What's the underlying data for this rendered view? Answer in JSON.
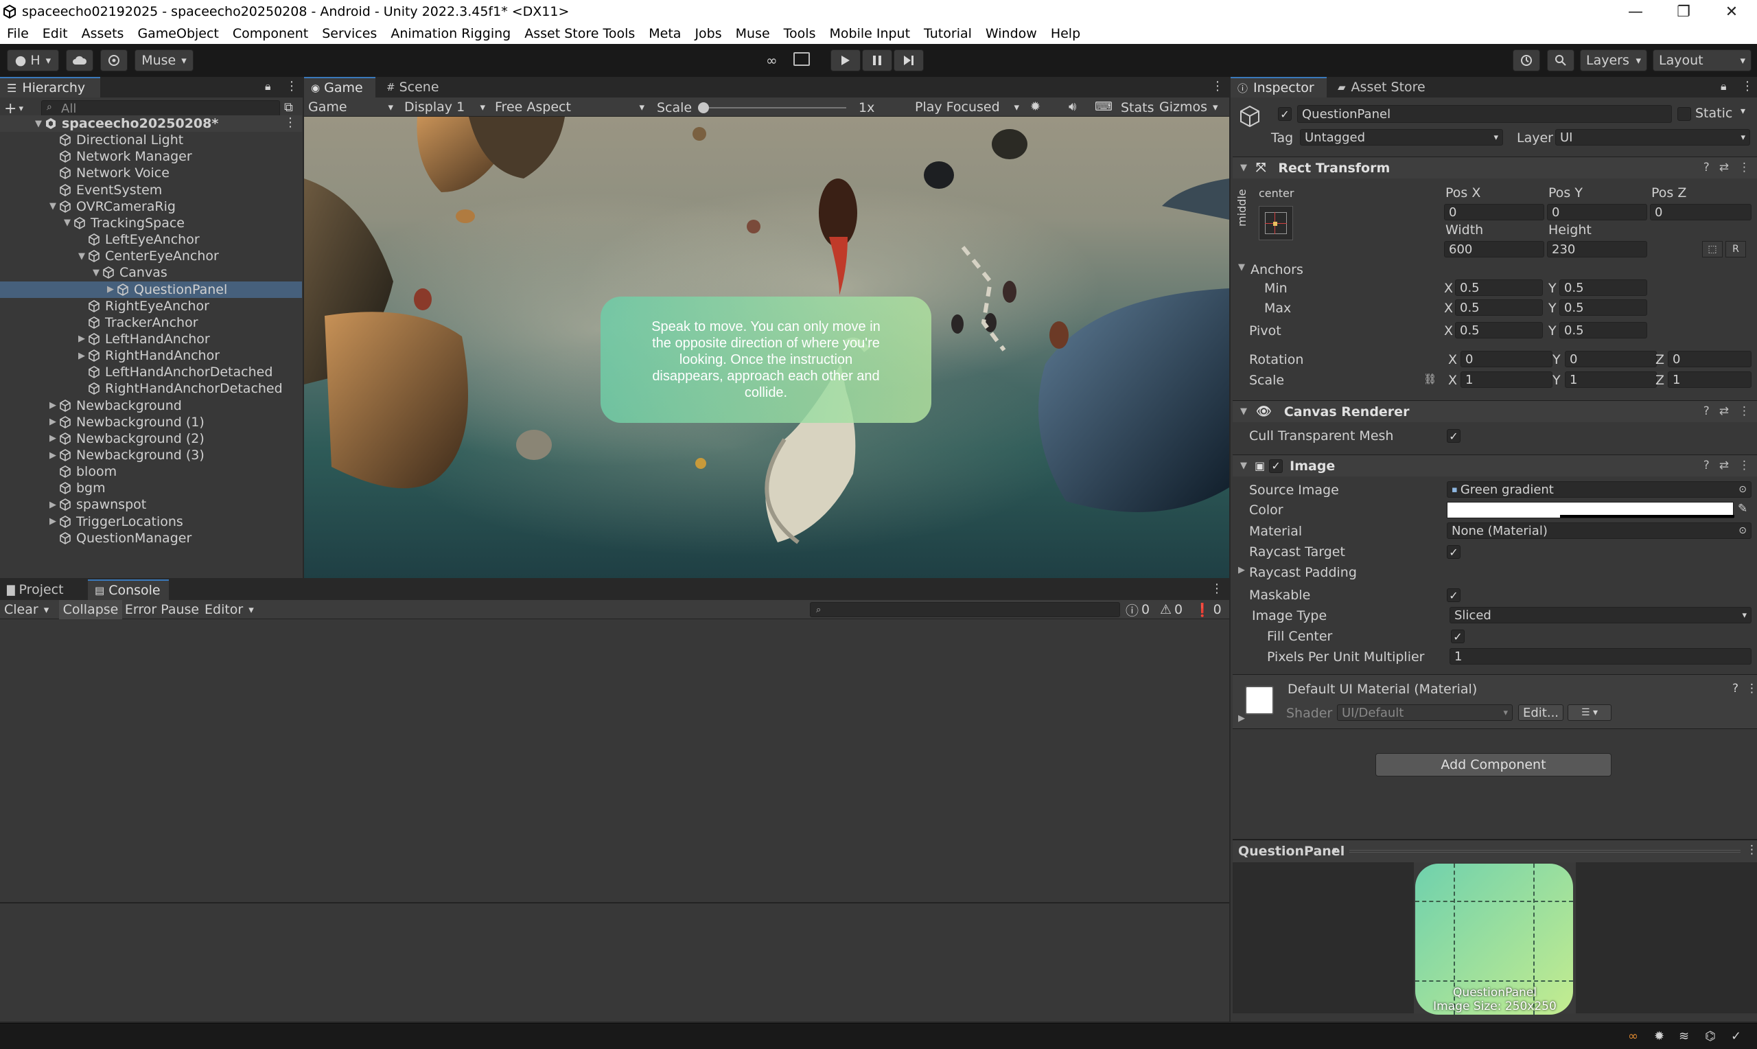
{
  "window": {
    "title": "spaceecho02192025 - spaceecho20250208 - Android - Unity 2022.3.45f1* <DX11>",
    "minimize": "—",
    "maximize": "❐",
    "close": "✕"
  },
  "menu": [
    "File",
    "Edit",
    "Assets",
    "GameObject",
    "Component",
    "Services",
    "Animation Rigging",
    "Asset Store Tools",
    "Meta",
    "Jobs",
    "Muse",
    "Tools",
    "Mobile Input",
    "Tutorial",
    "Window",
    "Help"
  ],
  "toolbar": {
    "account_label": "H",
    "muse_label": "Muse",
    "layers_label": "Layers",
    "layout_label": "Layout"
  },
  "hierarchy": {
    "tab": "Hierarchy",
    "search_placeholder": "All",
    "scene": "spaceecho20250208*",
    "items": [
      {
        "label": "Directional Light",
        "depth": 1,
        "arrow": ""
      },
      {
        "label": "Network Manager",
        "depth": 1,
        "arrow": ""
      },
      {
        "label": "Network Voice",
        "depth": 1,
        "arrow": ""
      },
      {
        "label": "EventSystem",
        "depth": 1,
        "arrow": ""
      },
      {
        "label": "OVRCameraRig",
        "depth": 1,
        "arrow": "▼"
      },
      {
        "label": "TrackingSpace",
        "depth": 2,
        "arrow": "▼"
      },
      {
        "label": "LeftEyeAnchor",
        "depth": 3,
        "arrow": ""
      },
      {
        "label": "CenterEyeAnchor",
        "depth": 3,
        "arrow": "▼"
      },
      {
        "label": "Canvas",
        "depth": 4,
        "arrow": "▼"
      },
      {
        "label": "QuestionPanel",
        "depth": 5,
        "arrow": "▶",
        "selected": true
      },
      {
        "label": "RightEyeAnchor",
        "depth": 3,
        "arrow": ""
      },
      {
        "label": "TrackerAnchor",
        "depth": 3,
        "arrow": ""
      },
      {
        "label": "LeftHandAnchor",
        "depth": 3,
        "arrow": "▶"
      },
      {
        "label": "RightHandAnchor",
        "depth": 3,
        "arrow": "▶"
      },
      {
        "label": "LeftHandAnchorDetached",
        "depth": 3,
        "arrow": ""
      },
      {
        "label": "RightHandAnchorDetached",
        "depth": 3,
        "arrow": ""
      },
      {
        "label": "Newbackground",
        "depth": 1,
        "arrow": "▶"
      },
      {
        "label": "Newbackground (1)",
        "depth": 1,
        "arrow": "▶"
      },
      {
        "label": "Newbackground (2)",
        "depth": 1,
        "arrow": "▶"
      },
      {
        "label": "Newbackground (3)",
        "depth": 1,
        "arrow": "▶"
      },
      {
        "label": "bloom",
        "depth": 1,
        "arrow": ""
      },
      {
        "label": "bgm",
        "depth": 1,
        "arrow": ""
      },
      {
        "label": "spawnspot",
        "depth": 1,
        "arrow": "▶"
      },
      {
        "label": "TriggerLocations",
        "depth": 1,
        "arrow": "▶"
      },
      {
        "label": "QuestionManager",
        "depth": 1,
        "arrow": ""
      }
    ]
  },
  "game": {
    "tab_game": "Game",
    "tab_scene": "Scene",
    "view_select": "Game",
    "display": "Display 1",
    "aspect": "Free Aspect",
    "scale_label": "Scale",
    "scale_value": "1x",
    "play_mode": "Play Focused",
    "stats": "Stats",
    "gizmos": "Gizmos",
    "instruction": "Speak to move. You can only move in the opposite direction of where you're looking. Once the instruction disappears, approach each other and collide."
  },
  "console": {
    "tab_project": "Project",
    "tab_console": "Console",
    "clear": "Clear",
    "collapse": "Collapse",
    "error_pause": "Error Pause",
    "editor": "Editor",
    "count_log": "0",
    "count_warn": "0",
    "count_error": "0"
  },
  "inspector": {
    "tab_inspector": "Inspector",
    "tab_asset_store": "Asset Store",
    "object_name": "QuestionPanel",
    "static_label": "Static",
    "tag_label": "Tag",
    "tag_value": "Untagged",
    "layer_label": "Layer",
    "layer_value": "UI",
    "rect": {
      "title": "Rect Transform",
      "anchor_h": "center",
      "anchor_v": "middle",
      "posx_label": "Pos X",
      "posy_label": "Pos Y",
      "posz_label": "Pos Z",
      "posx": "0",
      "posy": "0",
      "posz": "0",
      "width_label": "Width",
      "height_label": "Height",
      "width": "600",
      "height": "230",
      "anchors_label": "Anchors",
      "min_label": "Min",
      "max_label": "Max",
      "min_x": "0.5",
      "min_y": "0.5",
      "max_x": "0.5",
      "max_y": "0.5",
      "pivot_label": "Pivot",
      "pivot_x": "0.5",
      "pivot_y": "0.5",
      "rotation_label": "Rotation",
      "rot_x": "0",
      "rot_y": "0",
      "rot_z": "0",
      "scale_label": "Scale",
      "scale_x": "1",
      "scale_y": "1",
      "scale_z": "1",
      "x": "X",
      "y": "Y",
      "z": "Z"
    },
    "canvas_renderer": {
      "title": "Canvas Renderer",
      "cull_label": "Cull Transparent Mesh"
    },
    "image": {
      "title": "Image",
      "source_label": "Source Image",
      "source_value": "Green gradient",
      "color_label": "Color",
      "material_label": "Material",
      "material_value": "None (Material)",
      "raycast_label": "Raycast Target",
      "raycast_padding_label": "Raycast Padding",
      "maskable_label": "Maskable",
      "image_type_label": "Image Type",
      "image_type_value": "Sliced",
      "fill_center_label": "Fill Center",
      "ppu_label": "Pixels Per Unit Multiplier",
      "ppu_value": "1"
    },
    "material": {
      "title": "Default UI Material (Material)",
      "shader_label": "Shader",
      "shader_value": "UI/Default",
      "edit_label": "Edit..."
    },
    "add_component": "Add Component",
    "preview": {
      "title": "QuestionPanel",
      "caption_line1": "QuestionPanel",
      "caption_line2": "Image Size: 250x250"
    }
  },
  "colors": {
    "accent": "#3a79bb",
    "selection": "#46607c",
    "panel_green_start": "#6fd1ad",
    "panel_green_end": "#c4ec8f"
  }
}
